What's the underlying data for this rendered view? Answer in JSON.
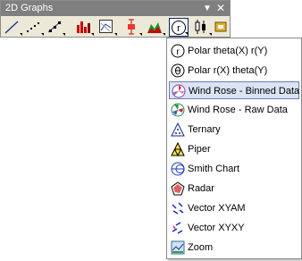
{
  "toolbar": {
    "title": "2D Graphs",
    "dropdown_glyph": "▼",
    "close_glyph": "✕",
    "buttons": [
      {
        "icon": "line-plot-icon"
      },
      {
        "icon": "scatter-plot-icon"
      },
      {
        "icon": "line-symbol-plot-icon"
      },
      {
        "icon": "bar-chart-icon"
      },
      {
        "icon": "boxed-chart-icon"
      },
      {
        "icon": "error-bar-icon"
      },
      {
        "icon": "area-chart-icon"
      },
      {
        "icon": "polar-chart-icon"
      },
      {
        "icon": "candlestick-icon"
      },
      {
        "icon": "template-icon"
      }
    ]
  },
  "menu": {
    "items": [
      {
        "label": "Polar theta(X) r(Y)",
        "icon": "polar-theta-r-icon"
      },
      {
        "label": "Polar r(X) theta(Y)",
        "icon": "polar-r-theta-icon"
      },
      {
        "label": "Wind Rose - Binned Data",
        "icon": "wind-rose-binned-icon",
        "highlighted": true
      },
      {
        "label": "Wind Rose - Raw Data",
        "icon": "wind-rose-raw-icon"
      },
      {
        "label": "Ternary",
        "icon": "ternary-icon"
      },
      {
        "label": "Piper",
        "icon": "piper-icon"
      },
      {
        "label": "Smith Chart",
        "icon": "smith-chart-icon"
      },
      {
        "label": "Radar",
        "icon": "radar-icon"
      },
      {
        "label": "Vector XYAM",
        "icon": "vector-xyam-icon"
      },
      {
        "label": "Vector  XYXY",
        "icon": "vector-xyxy-icon"
      },
      {
        "label": "Zoom",
        "icon": "zoom-icon"
      }
    ]
  },
  "colors": {
    "titlebar": "#7f7f7f",
    "toolbar_bg": "#ece9d8",
    "highlight_bg": "#dbe3f4",
    "highlight_border": "#6a7fb4"
  }
}
